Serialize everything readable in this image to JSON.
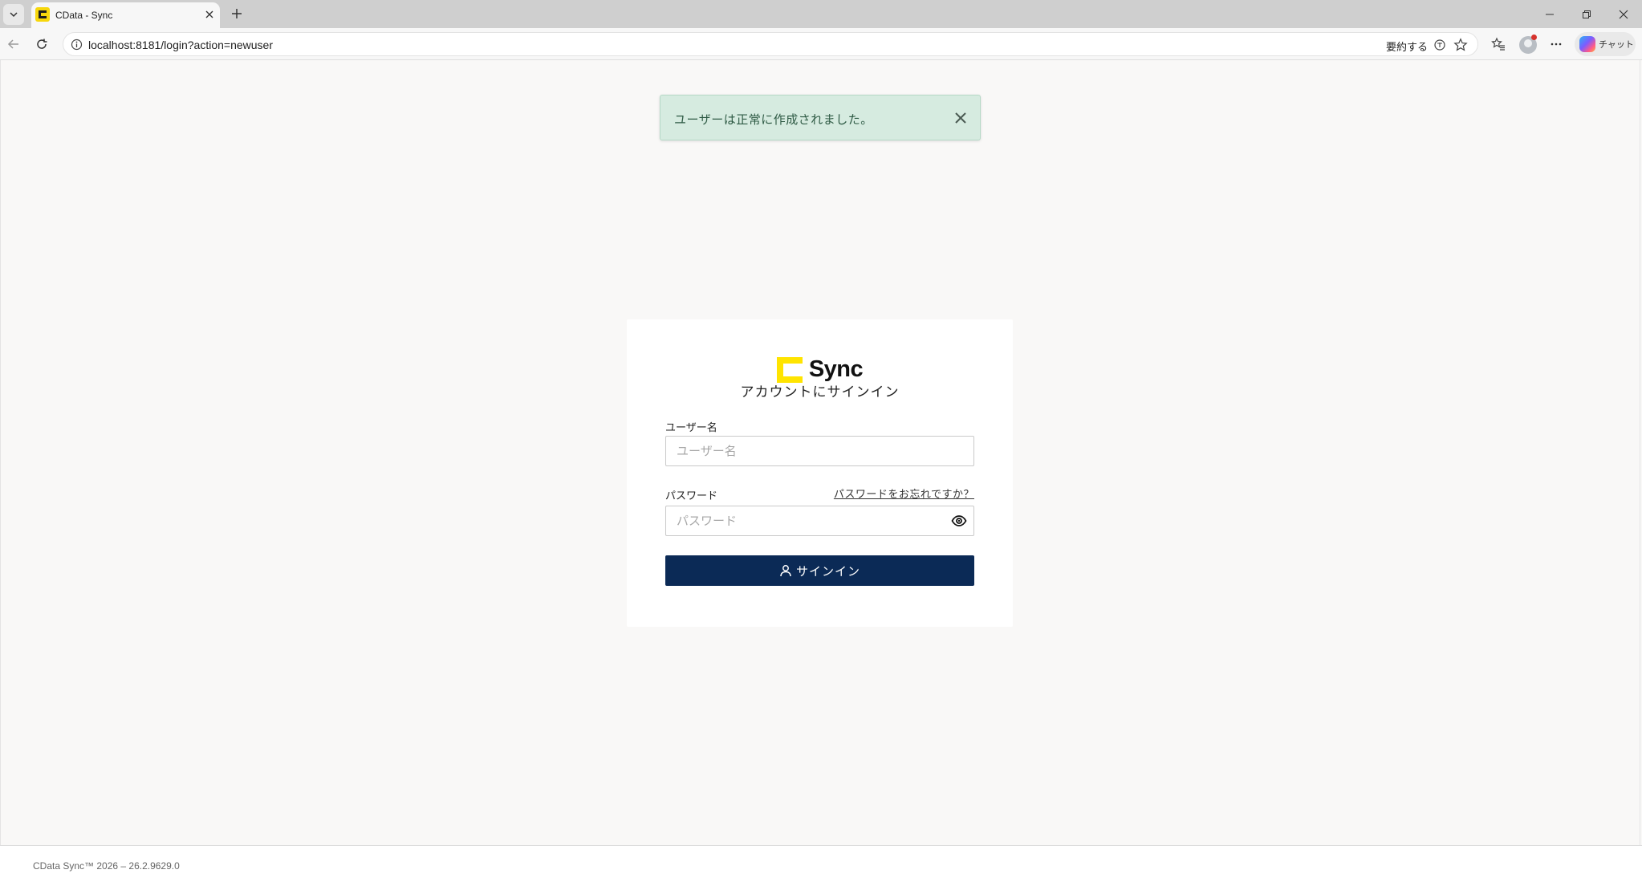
{
  "browser": {
    "tab_title": "CData - Sync",
    "url": "localhost:8181/login?action=newuser",
    "summarize_label": "要約する",
    "copilot_label": "チャット"
  },
  "toast": {
    "message": "ユーザーは正常に作成されました。"
  },
  "login": {
    "brand_name": "Sync",
    "heading": "アカウントにサインイン",
    "username_label": "ユーザー名",
    "username_placeholder": "ユーザー名",
    "password_label": "パスワード",
    "password_placeholder": "パスワード",
    "forgot_password": "パスワードをお忘れですか？",
    "signin_button": "サインイン"
  },
  "footer": {
    "text": "CData Sync™ 2026 – 26.2.9629.0"
  },
  "colors": {
    "brand_yellow": "#ffe400",
    "primary_navy": "#0b2a56",
    "toast_bg": "#d6ebe0",
    "toast_text": "#2e5a44"
  }
}
